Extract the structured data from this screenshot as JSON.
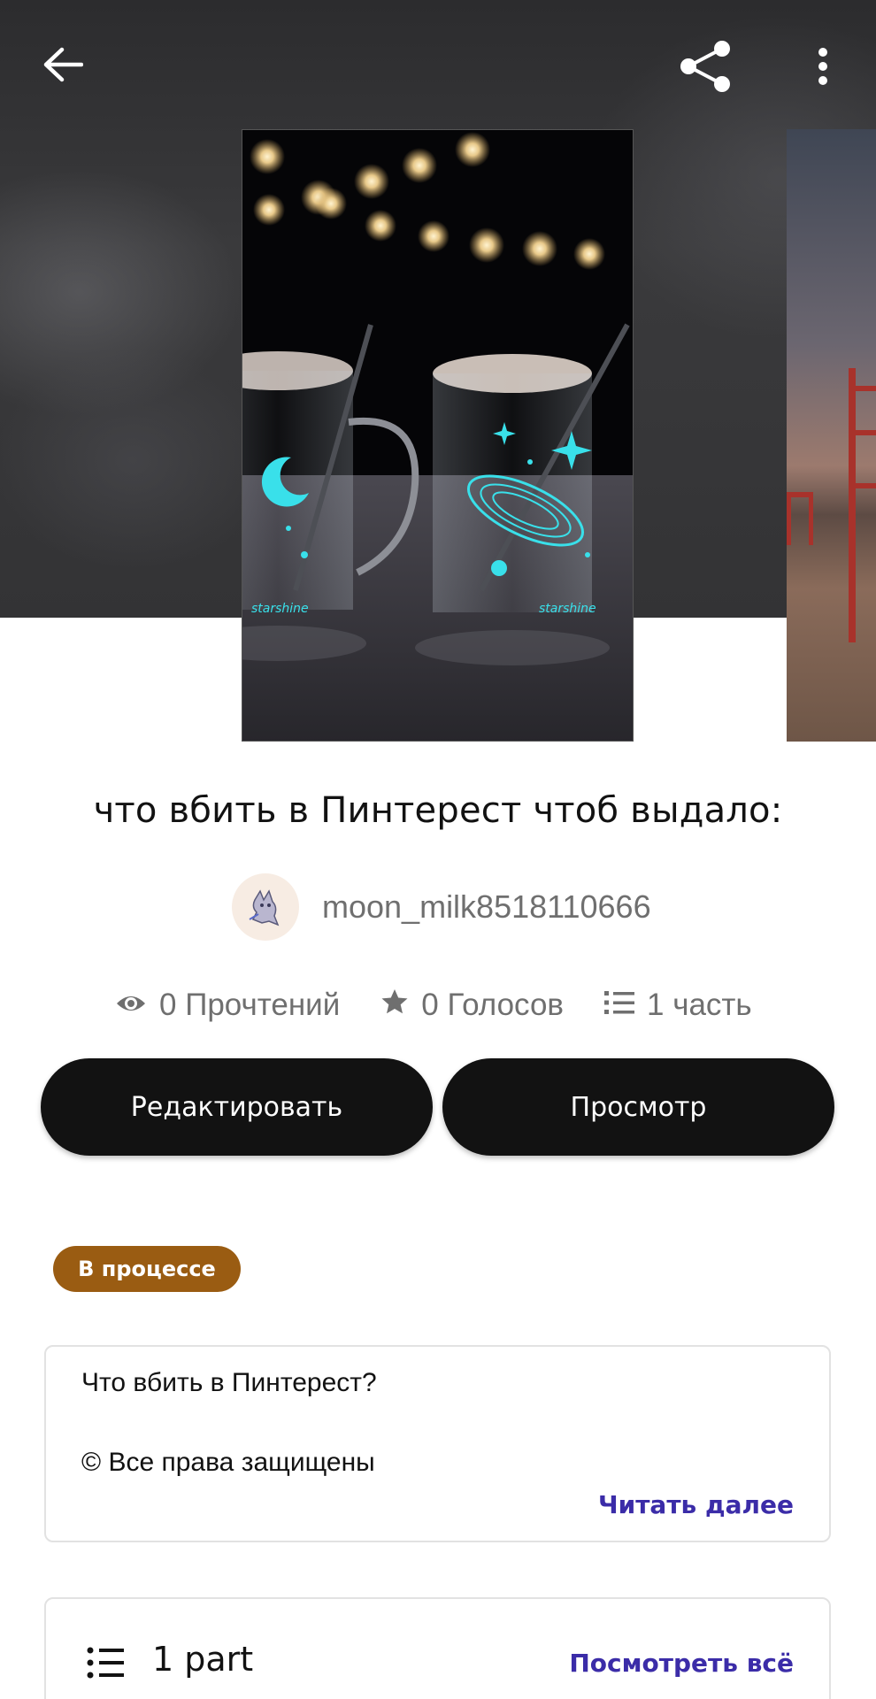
{
  "nav": {
    "back_icon": "arrow-left-icon",
    "share_icon": "share-icon",
    "more_icon": "more-vertical-icon"
  },
  "story": {
    "title": "что вбить в Пинтерест чтоб выдало:",
    "author": "moon_milk8518110666",
    "stats": {
      "reads": "0 Прочтений",
      "votes": "0 Голосов",
      "parts": "1 часть"
    },
    "status": "В процессе",
    "description": {
      "line1": "Что вбить в Пинтерест?",
      "line2": "© Все права защищены",
      "read_more": "Читать далее"
    }
  },
  "actions": {
    "edit": "Редактировать",
    "view": "Просмотр"
  },
  "parts_section": {
    "label": "1 part",
    "see_all": "Посмотреть всё"
  },
  "colors": {
    "button_bg": "#121212",
    "status_bg": "#9a5c12",
    "link": "#3b2ca8",
    "muted_text": "#6f6f6f"
  }
}
